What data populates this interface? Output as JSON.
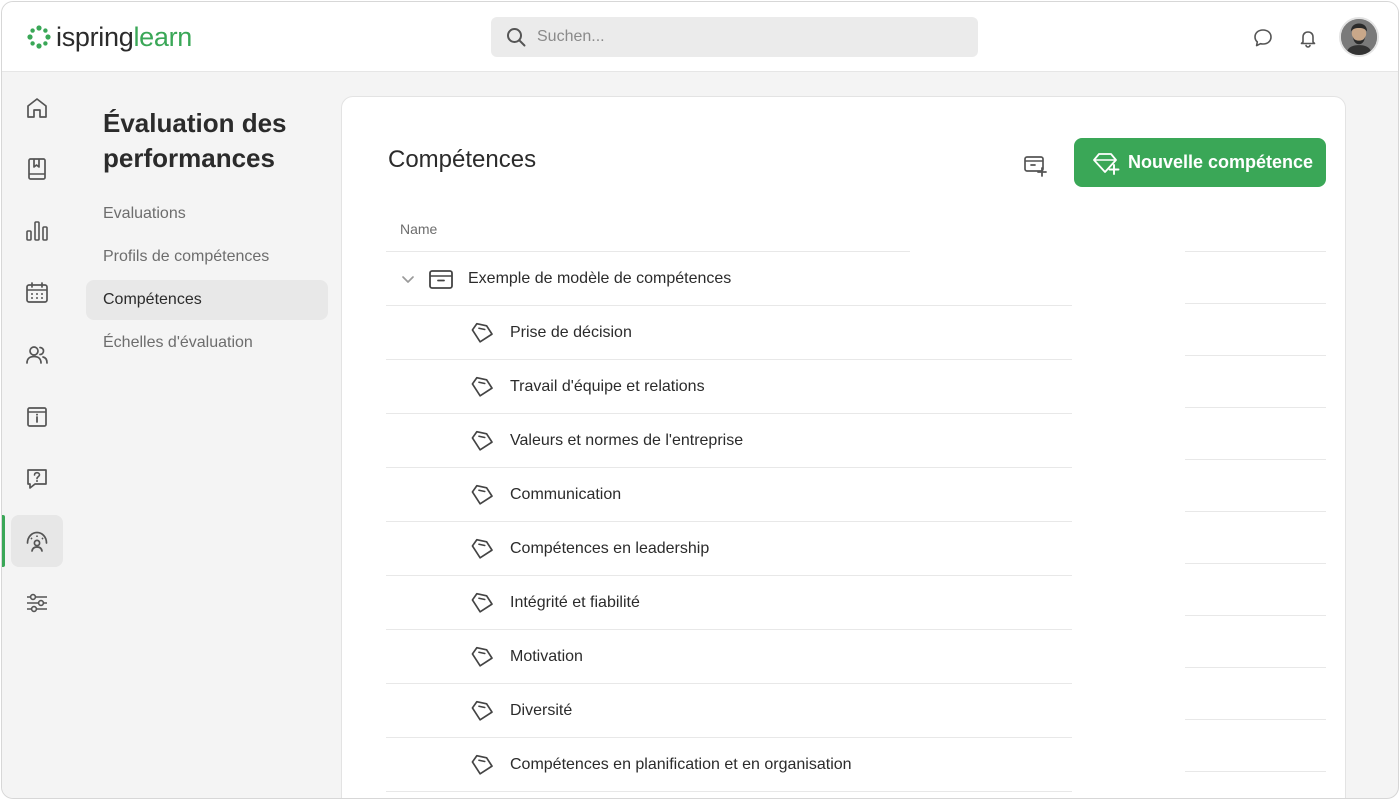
{
  "header": {
    "logo_part1": "ispring",
    "logo_part2": "learn",
    "search_placeholder": "Suchen..."
  },
  "rail": {
    "items": [
      "home-icon",
      "course-book-icon",
      "reports-chart-icon",
      "calendar-icon",
      "users-icon",
      "info-board-icon",
      "help-question-icon",
      "performance-gauge-icon",
      "settings-sliders-icon"
    ],
    "active_index": 7
  },
  "subnav": {
    "title": "Évaluation des performances",
    "items": [
      {
        "label": "Evaluations"
      },
      {
        "label": "Profils de compétences"
      },
      {
        "label": "Compétences"
      },
      {
        "label": "Échelles d'évaluation"
      }
    ],
    "active_index": 2
  },
  "main": {
    "title": "Compétences",
    "new_button_label": "Nouvelle compétence",
    "column_name": "Name",
    "group": {
      "label": "Exemple de modèle de compétences"
    },
    "items": [
      "Prise de décision",
      "Travail d'équipe et relations",
      "Valeurs et normes de l'entreprise",
      "Communication",
      "Compétences en leadership",
      "Intégrité et fiabilité",
      "Motivation",
      "Diversité",
      "Compétences en planification et en organisation"
    ]
  },
  "colors": {
    "accent": "#3aa757",
    "background": "#f4f4f4",
    "text": "#2b2b2b"
  }
}
